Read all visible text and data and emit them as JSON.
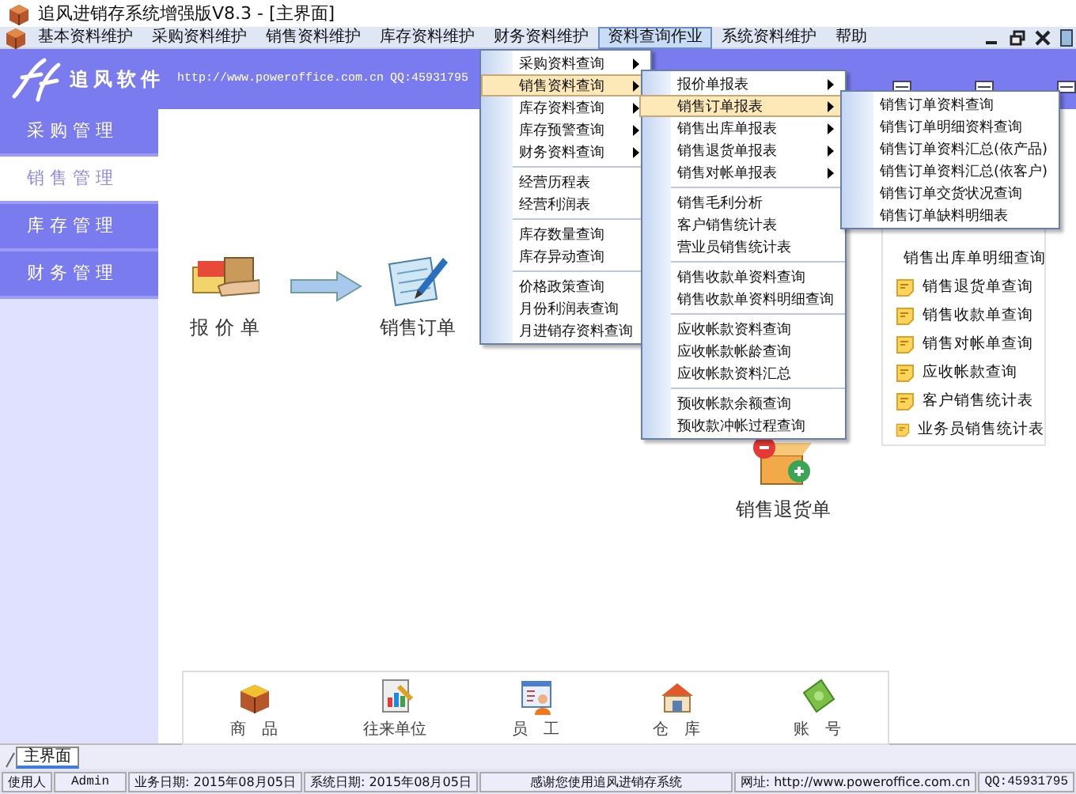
{
  "window": {
    "title": "追风进销存系统增强版V8.3 - [主界面]"
  },
  "menubar": [
    {
      "label": "基本资料维护",
      "selected": false
    },
    {
      "label": "采购资料维护",
      "selected": false
    },
    {
      "label": "销售资料维护",
      "selected": false
    },
    {
      "label": "库存资料维护",
      "selected": false
    },
    {
      "label": "财务资料维护",
      "selected": false
    },
    {
      "label": "资料查询作业",
      "selected": true
    },
    {
      "label": "系统资料维护",
      "selected": false
    },
    {
      "label": "帮助",
      "selected": false
    }
  ],
  "header": {
    "brand": "追风软件",
    "url": "http://www.poweroffice.com.cn",
    "qq": "QQ:45931795"
  },
  "sidebar": {
    "items": [
      {
        "label": "采 购 管 理",
        "selected": false
      },
      {
        "label": "销 售 管 理",
        "selected": true
      },
      {
        "label": "库 存 管 理",
        "selected": false
      },
      {
        "label": "财 务 管 理",
        "selected": false
      }
    ]
  },
  "workflow": {
    "nodes": [
      {
        "label": "报 价 单",
        "kind": "quote"
      },
      {
        "label": "销售订单",
        "kind": "order"
      },
      {
        "label": "销售退货单",
        "kind": "return"
      }
    ]
  },
  "quick_list": [
    "销售出库单明细查询",
    "销售退货单查询",
    "销售收款单查询",
    "销售对帐单查询",
    "应收帐款查询",
    "客户销售统计表",
    "业务员销售统计表"
  ],
  "shortcuts": [
    {
      "label": "商　品",
      "kind": "goods"
    },
    {
      "label": "往来单位",
      "kind": "partner"
    },
    {
      "label": "员　工",
      "kind": "staff"
    },
    {
      "label": "仓　库",
      "kind": "warehouse"
    },
    {
      "label": "账　号",
      "kind": "account"
    }
  ],
  "menus": [
    {
      "items": [
        {
          "kind": "item",
          "label": "采购资料查询",
          "submenu": true,
          "selected": false
        },
        {
          "kind": "item",
          "label": "销售资料查询",
          "submenu": true,
          "selected": true
        },
        {
          "kind": "item",
          "label": "库存资料查询",
          "submenu": true,
          "selected": false
        },
        {
          "kind": "item",
          "label": "库存预警查询",
          "submenu": true,
          "selected": false
        },
        {
          "kind": "item",
          "label": "财务资料查询",
          "submenu": true,
          "selected": false
        },
        {
          "kind": "separator"
        },
        {
          "kind": "item",
          "label": "经营历程表",
          "submenu": false,
          "selected": false
        },
        {
          "kind": "item",
          "label": "经营利润表",
          "submenu": false,
          "selected": false
        },
        {
          "kind": "separator"
        },
        {
          "kind": "item",
          "label": "库存数量查询",
          "submenu": false,
          "selected": false
        },
        {
          "kind": "item",
          "label": "库存异动查询",
          "submenu": false,
          "selected": false
        },
        {
          "kind": "separator"
        },
        {
          "kind": "item",
          "label": "价格政策查询",
          "submenu": false,
          "selected": false
        },
        {
          "kind": "item",
          "label": "月份利润表查询",
          "submenu": false,
          "selected": false
        },
        {
          "kind": "item",
          "label": "月进销存资料查询",
          "submenu": false,
          "selected": false
        }
      ]
    },
    {
      "items": [
        {
          "kind": "item",
          "label": "报价单报表",
          "submenu": true,
          "selected": false
        },
        {
          "kind": "item",
          "label": "销售订单报表",
          "submenu": true,
          "selected": true
        },
        {
          "kind": "item",
          "label": "销售出库单报表",
          "submenu": true,
          "selected": false
        },
        {
          "kind": "item",
          "label": "销售退货单报表",
          "submenu": true,
          "selected": false
        },
        {
          "kind": "item",
          "label": "销售对帐单报表",
          "submenu": true,
          "selected": false
        },
        {
          "kind": "separator"
        },
        {
          "kind": "item",
          "label": "销售毛利分析",
          "submenu": false,
          "selected": false
        },
        {
          "kind": "item",
          "label": "客户销售统计表",
          "submenu": false,
          "selected": false
        },
        {
          "kind": "item",
          "label": "营业员销售统计表",
          "submenu": false,
          "selected": false
        },
        {
          "kind": "separator"
        },
        {
          "kind": "item",
          "label": "销售收款单资料查询",
          "submenu": false,
          "selected": false
        },
        {
          "kind": "item",
          "label": "销售收款单资料明细查询",
          "submenu": false,
          "selected": false
        },
        {
          "kind": "separator"
        },
        {
          "kind": "item",
          "label": "应收帐款资料查询",
          "submenu": false,
          "selected": false
        },
        {
          "kind": "item",
          "label": "应收帐款帐龄查询",
          "submenu": false,
          "selected": false
        },
        {
          "kind": "item",
          "label": "应收帐款资料汇总",
          "submenu": false,
          "selected": false
        },
        {
          "kind": "separator"
        },
        {
          "kind": "item",
          "label": "预收帐款余额查询",
          "submenu": false,
          "selected": false
        },
        {
          "kind": "item",
          "label": "预收款冲帐过程查询",
          "submenu": false,
          "selected": false
        }
      ]
    },
    {
      "items": [
        {
          "kind": "item",
          "label": "销售订单资料查询",
          "submenu": false,
          "selected": false
        },
        {
          "kind": "item",
          "label": "销售订单明细资料查询",
          "submenu": false,
          "selected": false
        },
        {
          "kind": "item",
          "label": "销售订单资料汇总(依产品)",
          "submenu": false,
          "selected": false
        },
        {
          "kind": "item",
          "label": "销售订单资料汇总(依客户)",
          "submenu": false,
          "selected": false
        },
        {
          "kind": "item",
          "label": "销售订单交货状况查询",
          "submenu": false,
          "selected": false
        },
        {
          "kind": "item",
          "label": "销售订单缺料明细表",
          "submenu": false,
          "selected": false
        }
      ]
    }
  ],
  "tabs": [
    {
      "label": "主界面",
      "selected": true
    }
  ],
  "status_bar": [
    "使用人",
    "Admin",
    "业务日期: 2015年08月05日",
    "系统日期: 2015年08月05日",
    "感谢您使用追风进销存系统",
    "网址: http://www.poweroffice.com.cn",
    "QQ:45931795"
  ]
}
